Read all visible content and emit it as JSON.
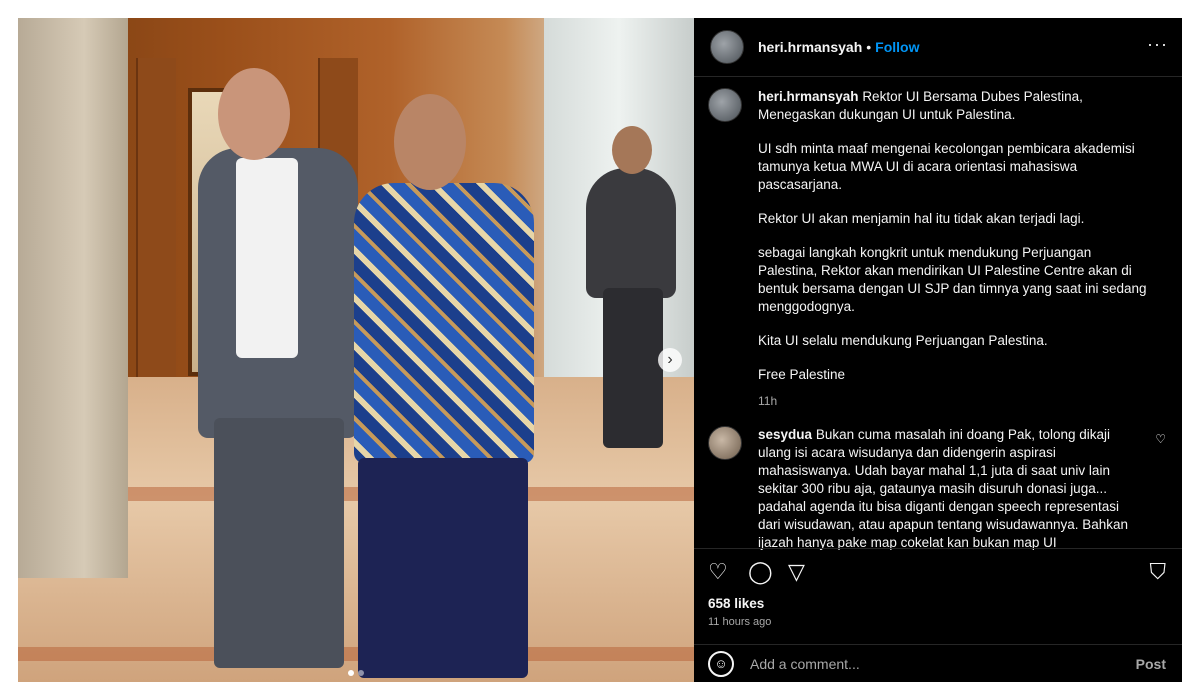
{
  "media": {
    "slide_count": 2,
    "active_slide": 1,
    "next_icon": "chevron-right-icon"
  },
  "header": {
    "username": "heri.hrmansyah",
    "separator": "•",
    "follow_label": "Follow",
    "more_icon": "···"
  },
  "caption": {
    "username": "heri.hrmansyah",
    "paragraphs": [
      "Rektor UI Bersama Dubes Palestina, Menegaskan dukungan UI untuk Palestina.",
      "UI sdh minta maaf mengenai kecolongan pembicara akademisi tamunya ketua MWA UI di acara orientasi mahasiswa pascasarjana.",
      "Rektor UI akan menjamin hal itu tidak akan terjadi lagi.",
      "sebagai langkah kongkrit untuk mendukung Perjuangan Palestina, Rektor akan mendirikan UI Palestine Centre akan di bentuk bersama dengan UI SJP dan timnya yang saat ini sedang menggodognya.",
      "Kita UI selalu mendukung Perjuangan Palestina.",
      "Free Palestine"
    ],
    "time": "11h"
  },
  "comment": {
    "username": "sesydua",
    "text": "Bukan cuma masalah ini doang Pak, tolong dikaji ulang isi acara wisudanya dan didengerin aspirasi mahasiswanya. Udah bayar mahal 1,1 juta di saat univ lain sekitar 300 ribu aja, gataunya masih disuruh donasi juga... padahal agenda itu bisa diganti dengan speech representasi dari wisudawan, atau apapun tentang wisudawannya. Bahkan ijazah hanya pake map cokelat kan bukan map UI"
  },
  "actions": {
    "like_icon": "♡",
    "comment_icon": "◯",
    "share_icon": "▽",
    "save_icon": "⛉"
  },
  "likes": "658 likes",
  "posted_ago": "11 hours ago",
  "add_comment": {
    "emoji_icon": "☺",
    "placeholder": "Add a comment...",
    "post_label": "Post"
  }
}
